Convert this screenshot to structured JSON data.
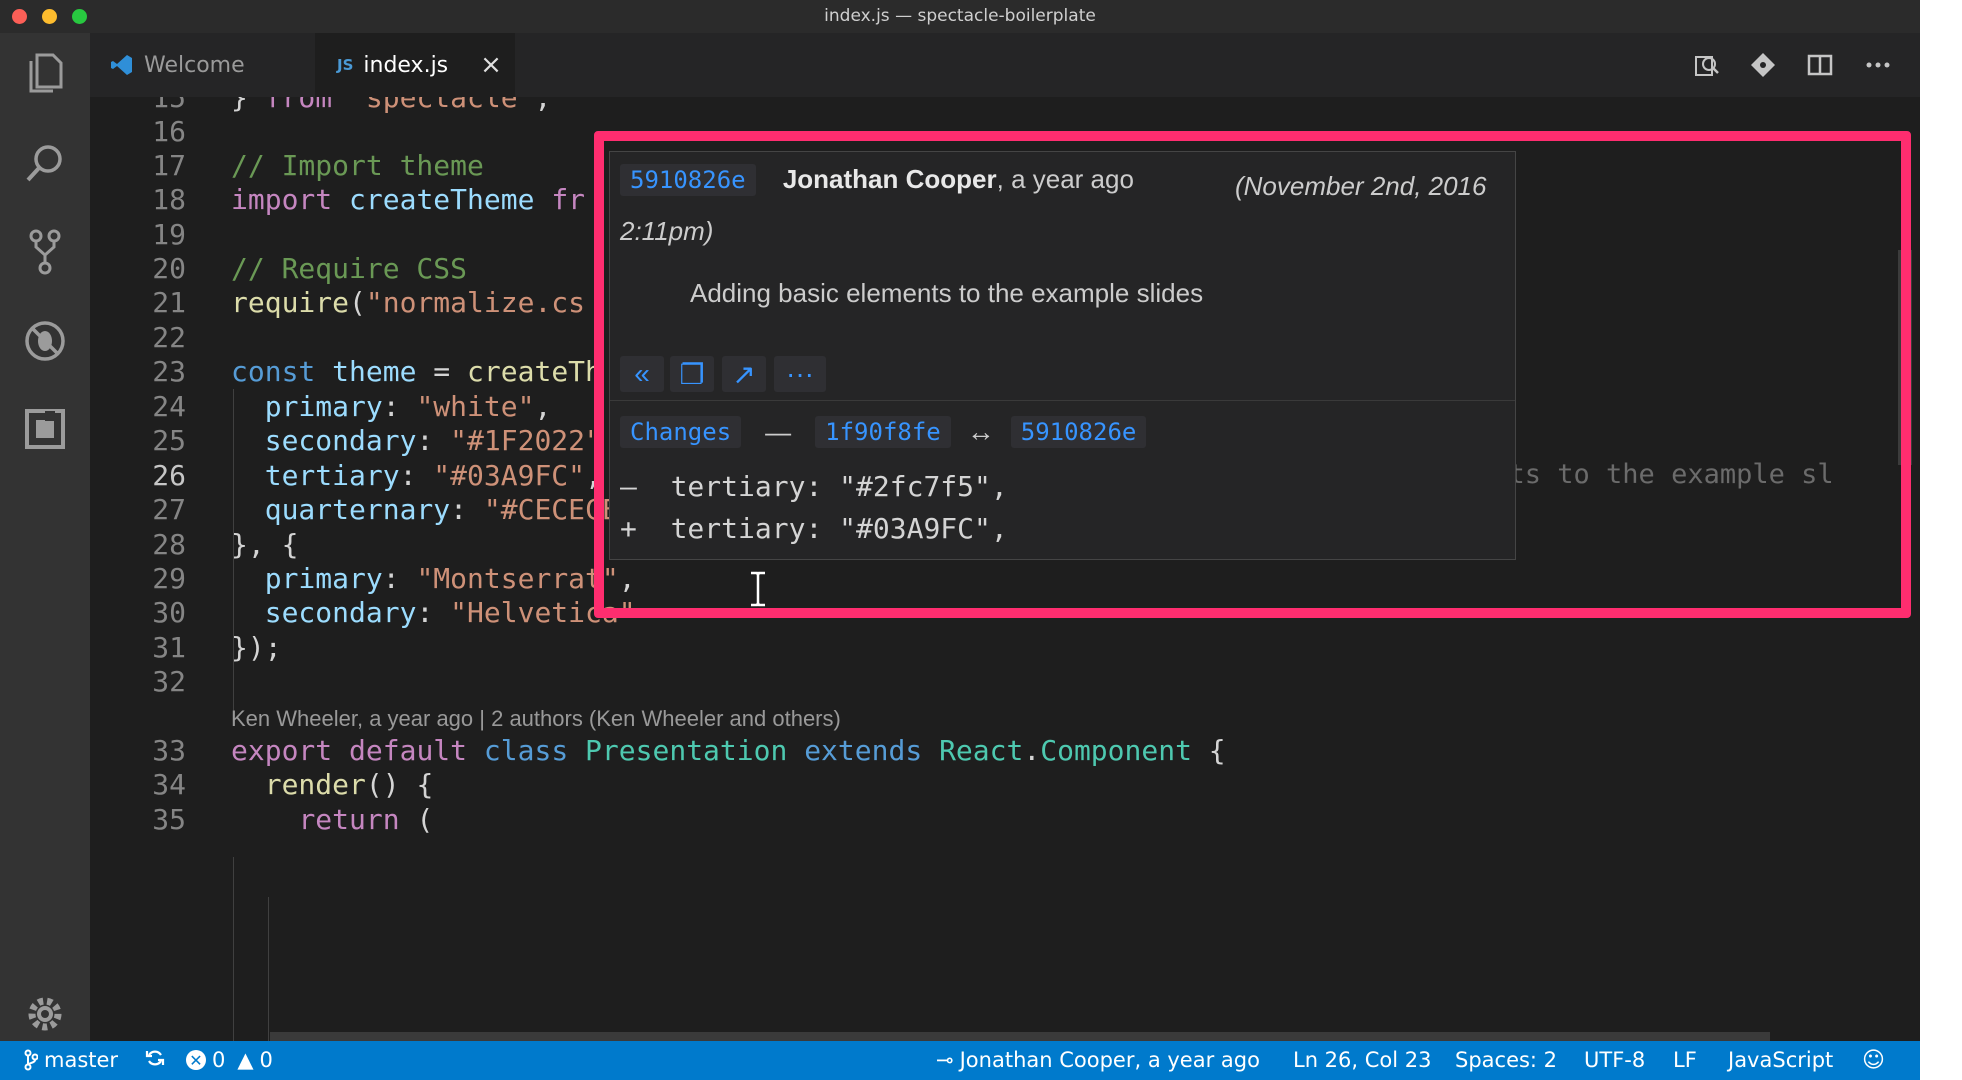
{
  "window": {
    "title": "index.js — spectacle-boilerplate"
  },
  "tabs": [
    {
      "label": "Welcome",
      "icon": "vscode-logo-icon"
    },
    {
      "label": "index.js",
      "icon_text": "JS",
      "close": "×"
    }
  ],
  "editor": {
    "lines": [
      {
        "n": "15",
        "t": "} from \"spectacle\";"
      },
      {
        "n": "16",
        "t": ""
      },
      {
        "n": "17",
        "t": "// Import theme"
      },
      {
        "n": "18",
        "t": "import createTheme fr"
      },
      {
        "n": "19",
        "t": ""
      },
      {
        "n": "20",
        "t": "// Require CSS"
      },
      {
        "n": "21",
        "t": "require(\"normalize.cs"
      },
      {
        "n": "22",
        "t": ""
      },
      {
        "n": "23",
        "t": "const theme = createTh"
      },
      {
        "n": "24",
        "t": "  primary: \"white\","
      },
      {
        "n": "25",
        "t": "  secondary: \"#1F2022\""
      },
      {
        "n": "26",
        "t": "  tertiary: \"#03A9FC\","
      },
      {
        "n": "27",
        "t": "  quarternary: \"#CECECE\""
      },
      {
        "n": "28",
        "t": "}, {"
      },
      {
        "n": "29",
        "t": "  primary: \"Montserrat\","
      },
      {
        "n": "30",
        "t": "  secondary: \"Helvetica\""
      },
      {
        "n": "31",
        "t": "});"
      },
      {
        "n": "32",
        "t": ""
      },
      {
        "n": "33",
        "t": "export default class Presentation extends React.Component {"
      },
      {
        "n": "34",
        "t": "  render() {"
      },
      {
        "n": "35",
        "t": "    return ("
      }
    ],
    "codelens": "Ken Wheeler, a year ago | 2 authors (Ken Wheeler and others)",
    "blame_inline": "Jonathan Cooper, a year ago • Adding basic elements to the example sl"
  },
  "hover": {
    "sha": "5910826e",
    "author": "Jonathan Cooper",
    "when": ", a year ago",
    "date": "(November 2nd, 2016 2:11pm)",
    "message": "Adding basic elements to the example slides",
    "buttons": [
      "«",
      "❐",
      "↗",
      "···"
    ],
    "changes_label": "Changes",
    "dash": "—",
    "from_sha": "1f90f8fe",
    "arrow": "↔",
    "to_sha": "5910826e",
    "diff": [
      {
        "sign": "–",
        "text": "tertiary: \"#2fc7f5\","
      },
      {
        "sign": "+",
        "text": "tertiary: \"#03A9FC\","
      }
    ]
  },
  "statusbar": {
    "branch": "master",
    "errors": "0",
    "warnings": "0",
    "blame": "Jonathan Cooper, a year ago",
    "position": "Ln 26, Col 23",
    "spaces": "Spaces: 2",
    "encoding": "UTF-8",
    "eol": "LF",
    "language": "JavaScript"
  },
  "colors": {
    "accent": "#007acc",
    "highlight": "#ff2d6f",
    "link": "#3794ff"
  }
}
